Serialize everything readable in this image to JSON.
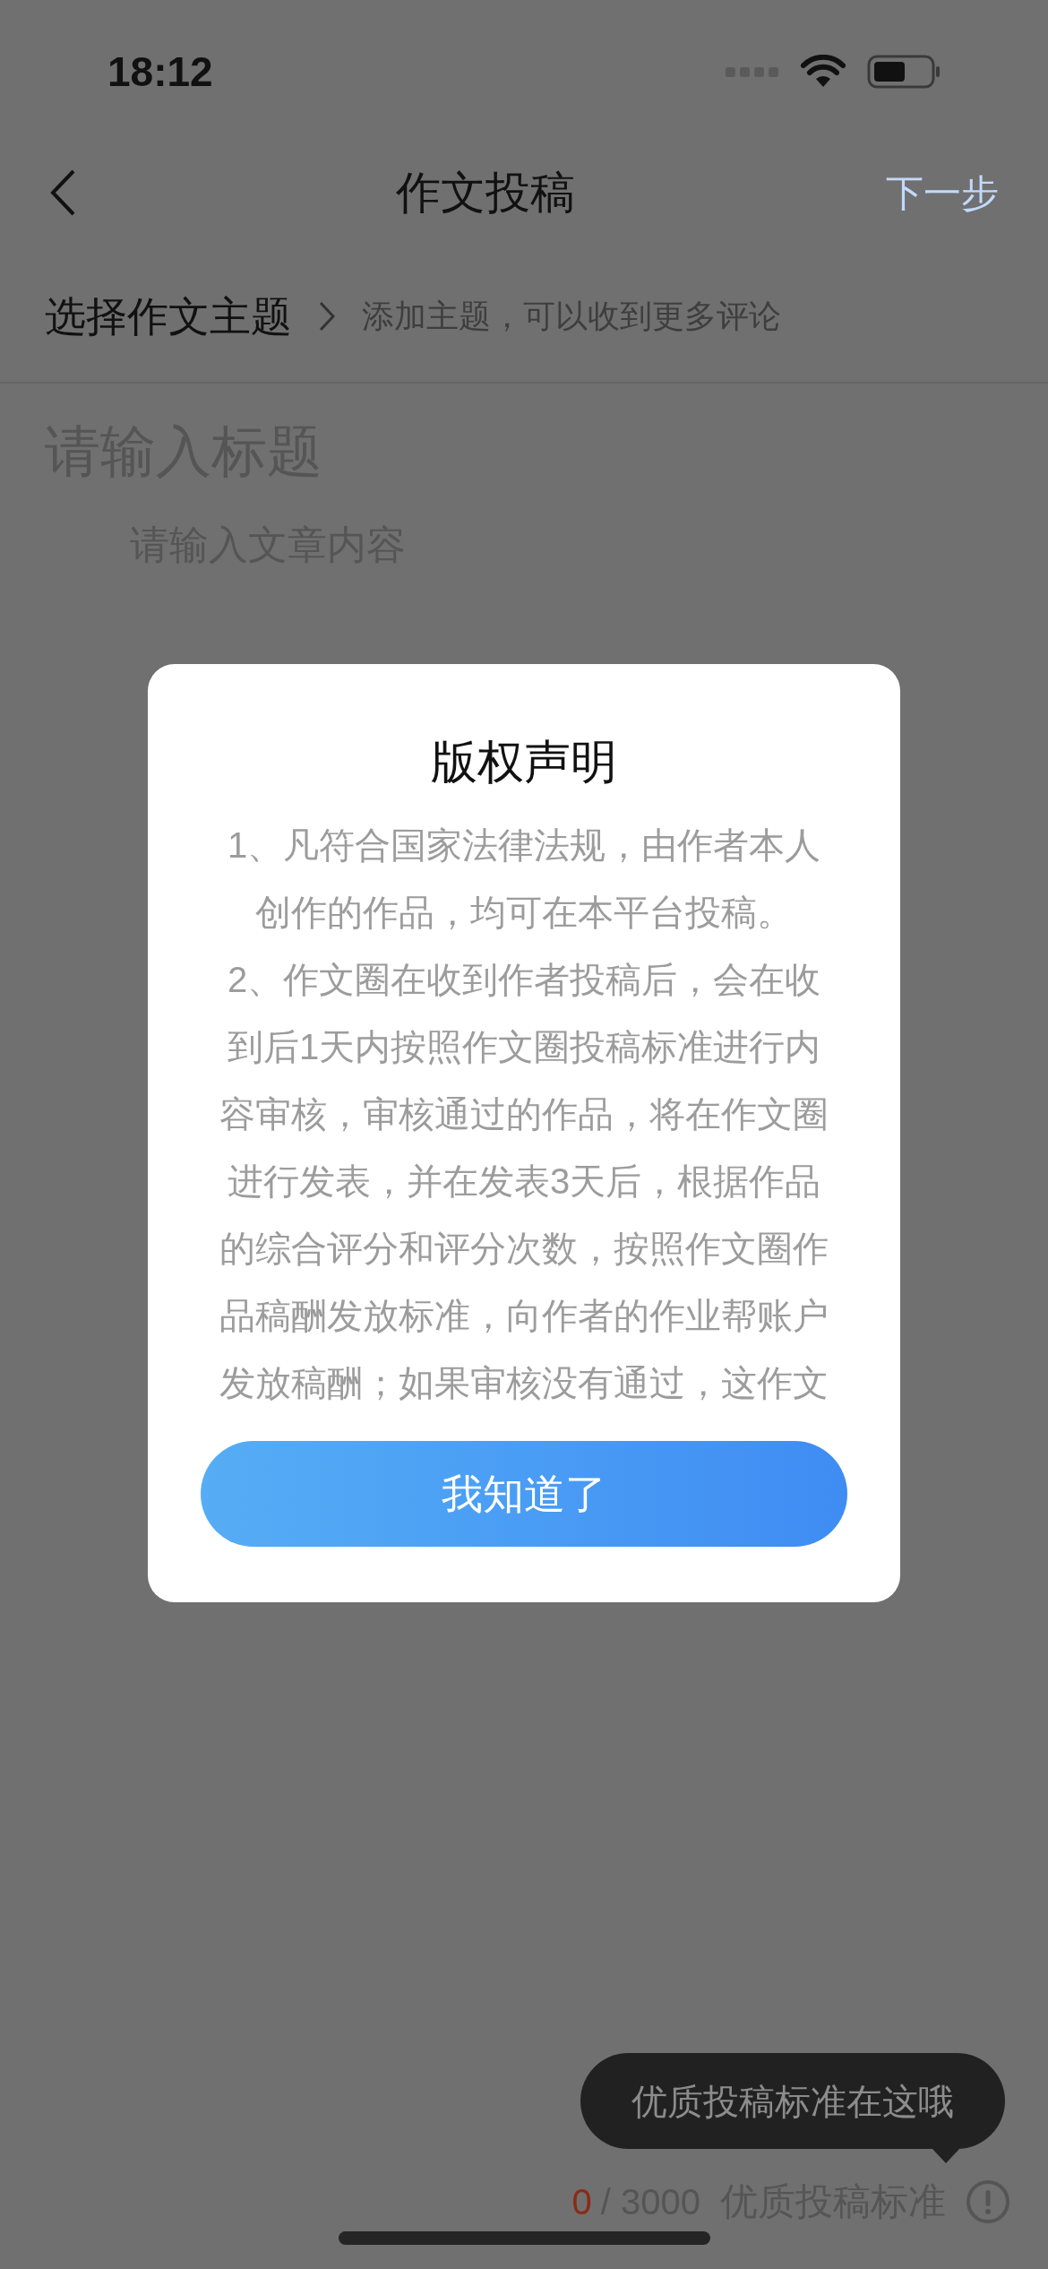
{
  "status_bar": {
    "time": "18:12"
  },
  "nav_bar": {
    "title": "作文投稿",
    "next": "下一步"
  },
  "topic": {
    "label": "选择作文主题",
    "hint": "添加主题，可以收到更多评论"
  },
  "editor": {
    "title_placeholder": "请输入标题",
    "content_placeholder": "请输入文章内容"
  },
  "dialog": {
    "title": "版权声明",
    "lines": [
      "1、凡符合国家法律法规，由作者本人",
      "创作的作品，均可在本平台投稿。",
      "2、作文圈在收到作者投稿后，会在收",
      "到后1天内按照作文圈投稿标准进行内",
      "容审核，审核通过的作品，将在作文圈",
      "进行发表，并在发表3天后，根据作品",
      "的综合评分和评分次数，按照作文圈作",
      "品稿酬发放标准，向作者的作业帮账户",
      "发放稿酬；如果审核没有通过，这作文"
    ],
    "button": "我知道了"
  },
  "tooltip": {
    "text": "优质投稿标准在这哦"
  },
  "footer": {
    "count": "0",
    "limit": "/ 3000",
    "standard": "优质投稿标准"
  }
}
